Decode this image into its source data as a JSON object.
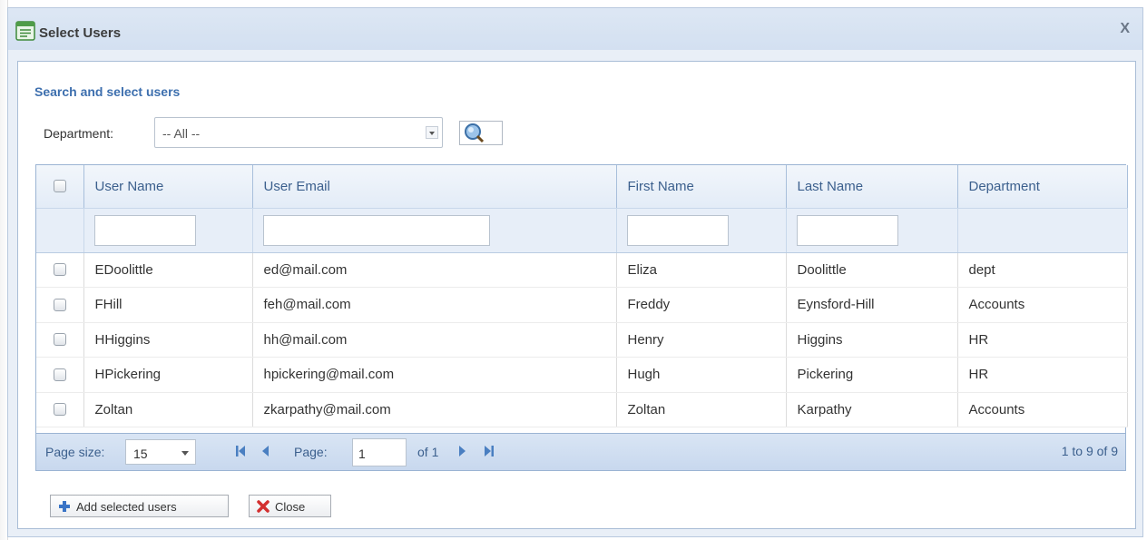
{
  "dialog": {
    "title": "Select Users",
    "close_glyph": "X"
  },
  "search": {
    "section_title": "Search and select users",
    "department_label": "Department:",
    "department_value": "-- All --"
  },
  "grid": {
    "columns": [
      "User Name",
      "User Email",
      "First Name",
      "Last Name",
      "Department"
    ],
    "rows": [
      {
        "user_name": "EDoolittle",
        "email": "ed@mail.com",
        "first": "Eliza",
        "last": "Doolittle",
        "dept": "dept"
      },
      {
        "user_name": "FHill",
        "email": "feh@mail.com",
        "first": "Freddy",
        "last": "Eynsford-Hill",
        "dept": "Accounts"
      },
      {
        "user_name": "HHiggins",
        "email": "hh@mail.com",
        "first": "Henry",
        "last": "Higgins",
        "dept": "HR"
      },
      {
        "user_name": "HPickering",
        "email": "hpickering@mail.com",
        "first": "Hugh",
        "last": "Pickering",
        "dept": "HR"
      },
      {
        "user_name": "Zoltan",
        "email": "zkarpathy@mail.com",
        "first": "Zoltan",
        "last": "Karpathy",
        "dept": "Accounts"
      }
    ]
  },
  "pager": {
    "page_size_label": "Page size:",
    "page_size_value": "15",
    "page_label": "Page:",
    "page_value": "1",
    "of_label": "of 1",
    "summary": "1 to 9 of 9"
  },
  "buttons": {
    "add_label": "Add selected users",
    "close_label": "Close"
  },
  "icons": [
    "form-icon",
    "close-icon",
    "search-icon",
    "first-page-icon",
    "prev-page-icon",
    "next-page-icon",
    "last-page-icon",
    "plus-icon",
    "red-x-icon"
  ],
  "colors": {
    "title_bar": "#d3e0f1",
    "accent": "#3d6fae",
    "header_text": "#3b5f8d",
    "grid_border": "#9bb4d3"
  }
}
